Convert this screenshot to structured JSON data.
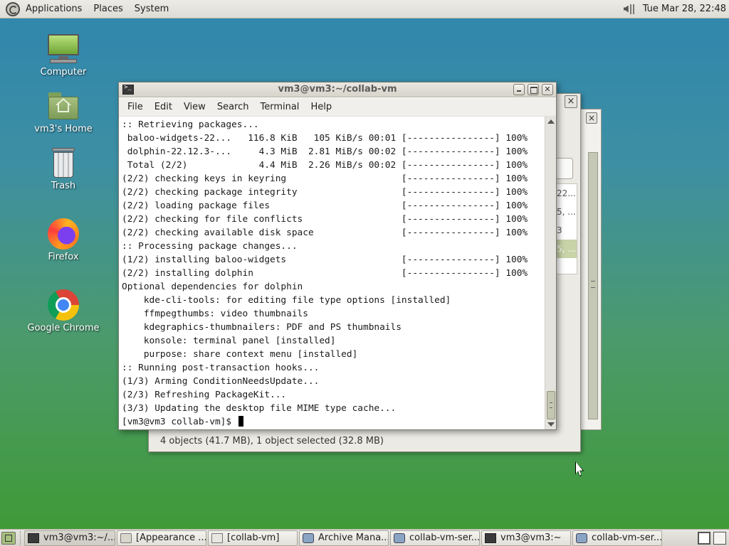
{
  "top_panel": {
    "menus": [
      "Applications",
      "Places",
      "System"
    ],
    "clock": "Tue Mar 28, 22:48"
  },
  "desktop_icons": [
    {
      "label": "Computer",
      "icon": "computer-icon"
    },
    {
      "label": "vm3's Home",
      "icon": "home-folder-icon"
    },
    {
      "label": "Trash",
      "icon": "trash-icon"
    },
    {
      "label": "Firefox",
      "icon": "firefox-icon"
    },
    {
      "label": "Google Chrome",
      "icon": "chrome-icon"
    }
  ],
  "file_window": {
    "fragments": [
      "22...",
      "5, ...",
      "3",
      "5, ..."
    ],
    "status": "4 objects (41.7 MB), 1 object selected (32.8 MB)"
  },
  "terminal": {
    "title": "vm3@vm3:~/collab-vm",
    "menus": [
      "File",
      "Edit",
      "View",
      "Search",
      "Terminal",
      "Help"
    ],
    "lines": [
      ":: Retrieving packages...",
      " baloo-widgets-22...   116.8 KiB   105 KiB/s 00:01 [----------------] 100%",
      " dolphin-22.12.3-...     4.3 MiB  2.81 MiB/s 00:02 [----------------] 100%",
      " Total (2/2)             4.4 MiB  2.26 MiB/s 00:02 [----------------] 100%",
      "(2/2) checking keys in keyring                     [----------------] 100%",
      "(2/2) checking package integrity                   [----------------] 100%",
      "(2/2) loading package files                        [----------------] 100%",
      "(2/2) checking for file conflicts                  [----------------] 100%",
      "(2/2) checking available disk space                [----------------] 100%",
      ":: Processing package changes...",
      "(1/2) installing baloo-widgets                     [----------------] 100%",
      "(2/2) installing dolphin                           [----------------] 100%",
      "Optional dependencies for dolphin",
      "    kde-cli-tools: for editing file type options [installed]",
      "    ffmpegthumbs: video thumbnails",
      "    kdegraphics-thumbnailers: PDF and PS thumbnails",
      "    konsole: terminal panel [installed]",
      "    purpose: share context menu [installed]",
      ":: Running post-transaction hooks...",
      "(1/3) Arming ConditionNeedsUpdate...",
      "(2/3) Refreshing PackageKit...",
      "(3/3) Updating the desktop file MIME type cache..."
    ],
    "prompt": "[vm3@vm3 collab-vm]$ "
  },
  "taskbar": {
    "tasks": [
      {
        "label": "vm3@vm3:~/...",
        "icon": "terminal-icon"
      },
      {
        "label": "[Appearance ...",
        "icon": "appearance-icon"
      },
      {
        "label": "[collab-vm]",
        "icon": "folder-icon"
      },
      {
        "label": "Archive Mana...",
        "icon": "archive-icon"
      },
      {
        "label": "collab-vm-ser...",
        "icon": "archive-icon"
      },
      {
        "label": "vm3@vm3:~",
        "icon": "terminal-icon"
      },
      {
        "label": "collab-vm-ser...",
        "icon": "archive-icon"
      }
    ]
  }
}
